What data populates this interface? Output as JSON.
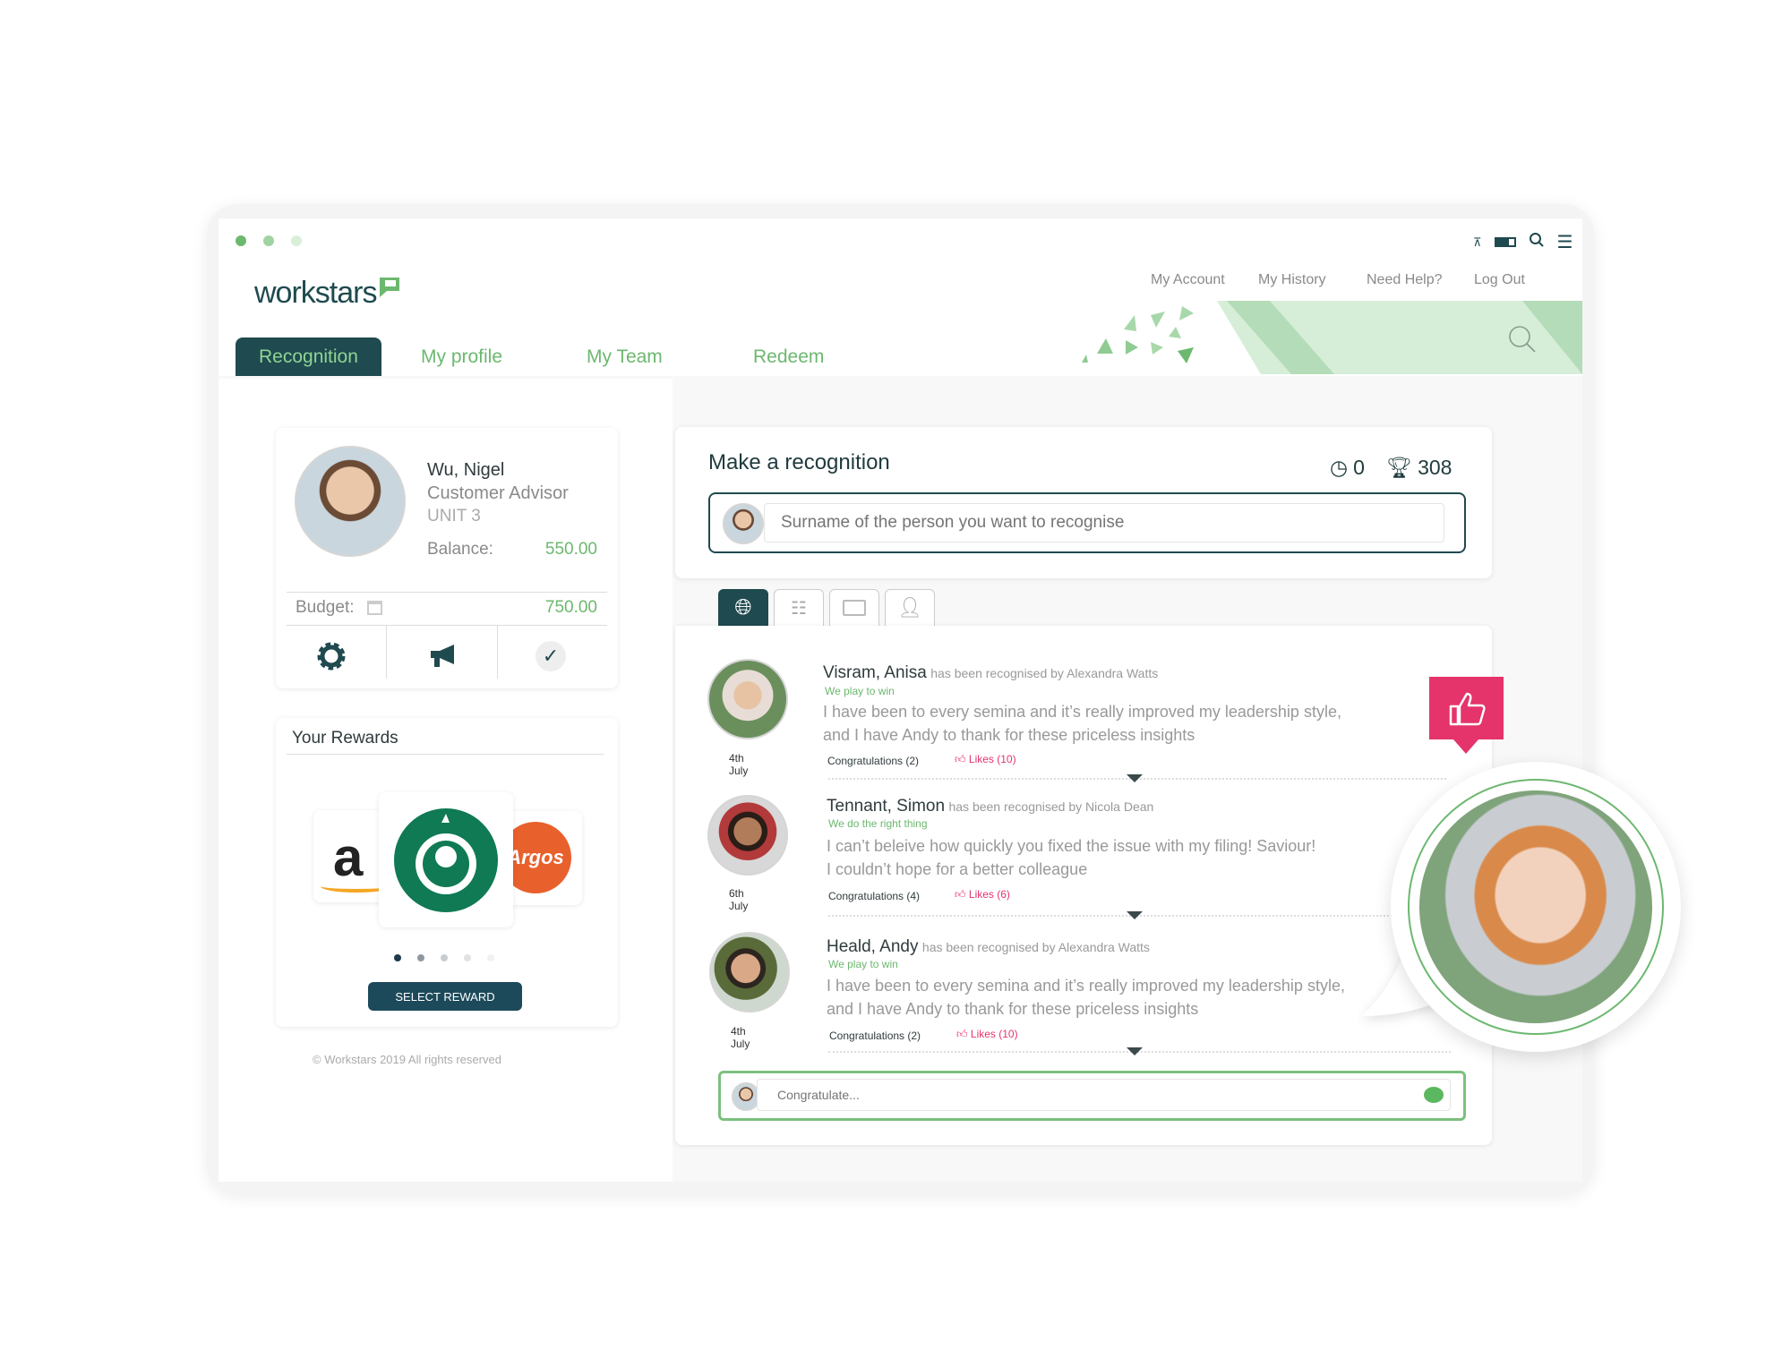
{
  "colors": {
    "primary": "#1f4a4f",
    "accent": "#6cb86f",
    "like": "#e5336b"
  },
  "window": {
    "status_icons": [
      "wifi-icon",
      "battery-icon",
      "search-icon",
      "menu-icon"
    ]
  },
  "brand": {
    "logo": "workstars"
  },
  "top_links": [
    "My Account",
    "My History",
    "Need Help?",
    "Log Out"
  ],
  "nav": {
    "tabs": [
      {
        "label": "Recognition",
        "active": true
      },
      {
        "label": "My profile"
      },
      {
        "label": "My Team"
      },
      {
        "label": "Redeem"
      }
    ]
  },
  "profile": {
    "name": "Wu, Nigel",
    "title": "Customer Advisor",
    "unit": "UNIT 3",
    "balance_label": "Balance:",
    "balance": "550.00",
    "budget_label": "Budget:",
    "budget": "750.00",
    "actions": [
      "gear-icon",
      "megaphone-icon",
      "check-icon"
    ]
  },
  "rewards": {
    "title": "Your Rewards",
    "brands": [
      "a",
      "Starbucks",
      "Argos"
    ],
    "carousel_pages": 5,
    "carousel_active": 1,
    "button": "SELECT REWARD"
  },
  "footer": {
    "copyright": "Workstars 2019 All rights reserved"
  },
  "recognition": {
    "title": "Make a recognition",
    "pending": "0",
    "trophies": "308",
    "search_placeholder": "Surname of the person you want to recognise"
  },
  "filter_tabs": [
    "globe-icon",
    "org-chart-icon",
    "id-card-icon",
    "person-icon"
  ],
  "feed": [
    {
      "name": "Visram, Anisa",
      "by": "has been recognised by Alexandra Watts",
      "motto": "We play to win",
      "message1": "I have been to every semina and it’s really improved my leadership style,",
      "message2": "and I have Andy to thank for these priceless insights",
      "date": "4th July",
      "congrats": "Congratulations (2)",
      "likes": "Likes (10)"
    },
    {
      "name": "Tennant, Simon",
      "by": "has been recognised by Nicola Dean",
      "motto": "We do the right thing",
      "message1": "I can’t beleive how quickly you fixed the issue with my filing! Saviour!",
      "message2": "I couldn’t hope for a better colleague",
      "date": "6th July",
      "congrats": "Congratulations (4)",
      "likes": "Likes (6)"
    },
    {
      "name": "Heald, Andy",
      "by": "has been recognised by Alexandra Watts",
      "motto": "We play to win",
      "message1": "I have been to every semina and it’s really improved my leadership style,",
      "message2": "and I have Andy to thank for these priceless insights",
      "date": "4th July",
      "congrats": "Congratulations (2)",
      "likes": "Likes (10)"
    }
  ],
  "comment": {
    "placeholder": "Congratulate..."
  }
}
